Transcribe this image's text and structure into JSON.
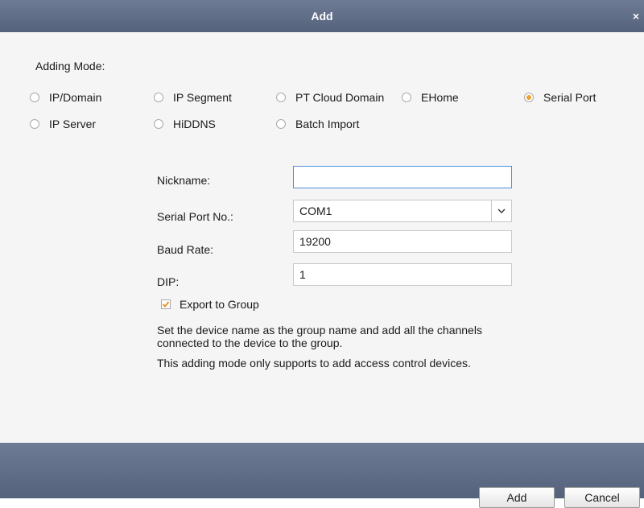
{
  "dialog": {
    "title": "Add",
    "close_glyph": "×"
  },
  "adding_mode": {
    "label": "Adding Mode:",
    "options": [
      {
        "label": "IP/Domain",
        "checked": false
      },
      {
        "label": "IP Segment",
        "checked": false
      },
      {
        "label": "PT Cloud Domain",
        "checked": false
      },
      {
        "label": "EHome",
        "checked": false
      },
      {
        "label": "Serial Port",
        "checked": true
      },
      {
        "label": "IP Server",
        "checked": false
      },
      {
        "label": "HiDDNS",
        "checked": false
      },
      {
        "label": "Batch Import",
        "checked": false
      }
    ]
  },
  "form": {
    "nickname": {
      "label": "Nickname:",
      "value": ""
    },
    "serial_port": {
      "label": "Serial Port No.:",
      "value": "COM1"
    },
    "baud_rate": {
      "label": "Baud Rate:",
      "value": "19200"
    },
    "dip": {
      "label": "DIP:",
      "value": "1"
    },
    "export_to_group": {
      "label": "Export to Group",
      "checked": true
    }
  },
  "notes": {
    "group_line1": "Set the device name as the group name and add all the channels",
    "group_line2": "connected to the device to the group.",
    "support": "This adding mode only supports to add access control devices."
  },
  "footer": {
    "add_label": "Add",
    "cancel_label": "Cancel"
  },
  "colors": {
    "titlebar": "#5f6c86",
    "radio_selected": "#f0a030",
    "checkbox_check": "#e8962a",
    "input_focus": "#4a90d9"
  }
}
